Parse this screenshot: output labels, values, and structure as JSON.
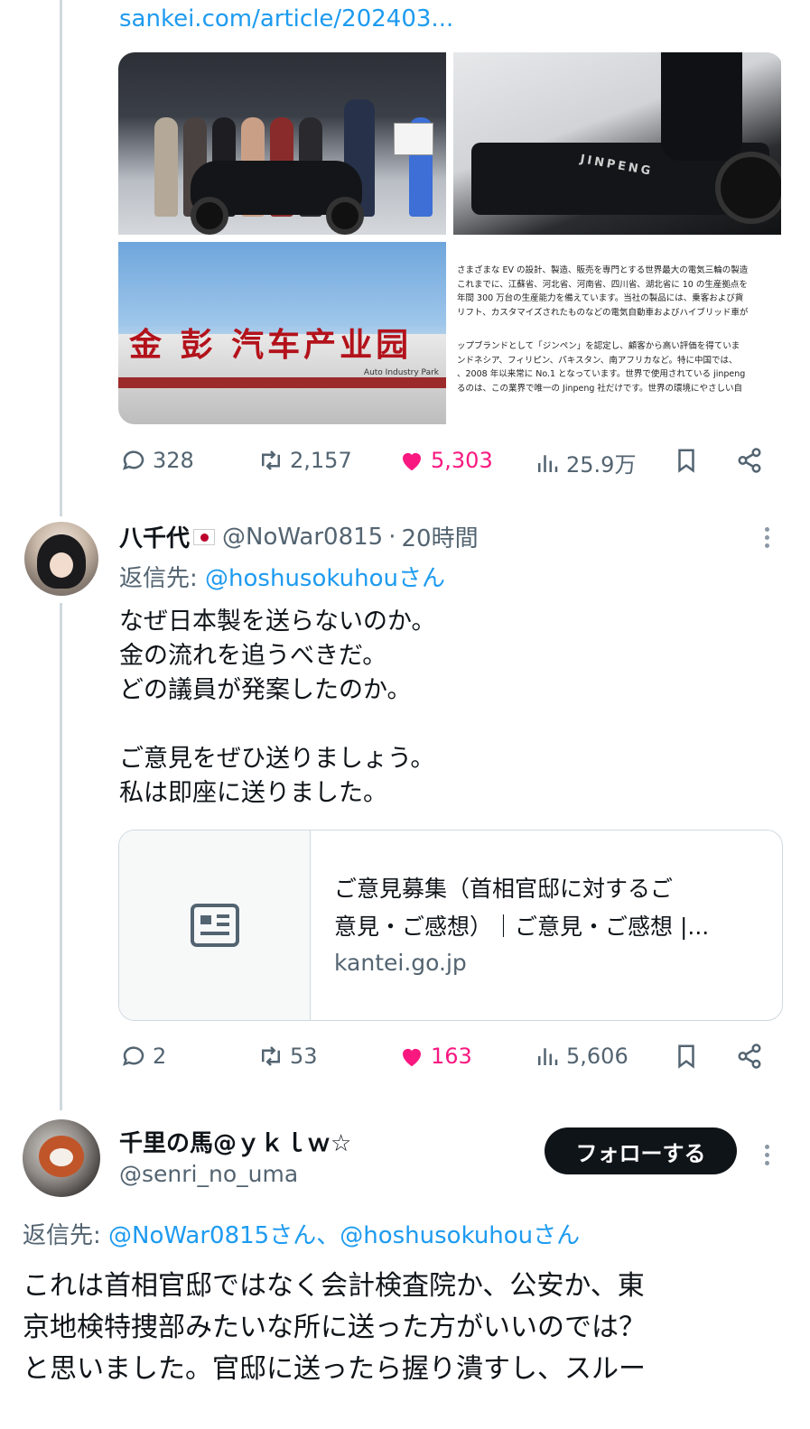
{
  "tweet1": {
    "link_text": "sankei.com/article/202403...",
    "media": {
      "image3_sign": "金 彭 汽车产业园",
      "image3_sign_sub": "Auto Industry Park",
      "image2_brand": "JINPENG",
      "image4_text_lines": [
        "さまざまな EV の設計、製造、販売を専門とする世界最大の電気三輪の製造",
        "これまでに、江蘇省、河北省、河南省、四川省、湖北省に 10 の生産拠点を",
        "年間 300 万台の生産能力を備えています。当社の製品には、乗客および貨",
        "リフト、カスタマイズされたものなどの電気自動車およびハイブリッド車が",
        "",
        "ップブランドとして「ジンペン」を認定し、顧客から高い評価を得ていま",
        "ンドネシア、フィリピン、パキスタン、南アフリカなど。特に中国では、",
        "、2008 年以来常に No.1 となっています。世界で使用されている jinpeng",
        "るのは、この業界で唯一の Jinpeng 社だけです。世界の環境にやさしい自"
      ]
    },
    "actions": {
      "replies": "328",
      "retweets": "2,157",
      "likes": "5,303",
      "views": "25.9万"
    }
  },
  "tweet2": {
    "display_name": "八千代",
    "handle": "@NoWar0815",
    "separator": "·",
    "time": "20時間",
    "reply_label": "返信先:",
    "reply_target": "@hoshusokuhouさん",
    "body_lines": [
      "なぜ日本製を送らないのか。",
      "金の流れを追うべきだ。",
      "どの議員が発案したのか。",
      "",
      "ご意見をぜひ送りましょう。",
      "私は即座に送りました。"
    ],
    "card": {
      "title_line1": "ご意見募集（首相官邸に対するご",
      "title_line2": "意見・ご感想）｜ご意見・ご感想 |...",
      "domain": "kantei.go.jp"
    },
    "actions": {
      "replies": "2",
      "retweets": "53",
      "likes": "163",
      "views": "5,606"
    }
  },
  "tweet3": {
    "display_name": "千里の馬@ｙｋｌｗ☆",
    "handle": "@senri_no_uma",
    "follow_label": "フォローする",
    "reply_label": "返信先:",
    "reply_target": "@NoWar0815さん、@hoshusokuhouさん",
    "body_lines": [
      "これは首相官邸ではなく会計検査院か、公安か、東",
      "京地検特捜部みたいな所に送った方がいいのでは？",
      "と思いました。官邸に送ったら握り潰すし、スルー"
    ]
  },
  "colors": {
    "accent": "#1d9bf0",
    "like": "#f91880",
    "text": "#0f1419",
    "secondary": "#536471",
    "border": "#cfd9de"
  },
  "icons": [
    "reply-icon",
    "retweet-icon",
    "like-icon",
    "views-icon",
    "bookmark-icon",
    "share-icon",
    "more-icon",
    "article-icon",
    "flag-jp-icon"
  ]
}
